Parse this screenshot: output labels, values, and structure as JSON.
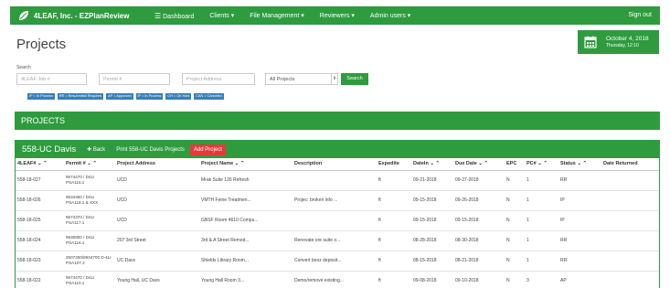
{
  "nav": {
    "brand": "4LEAF, Inc. - EZPlanReview",
    "menu": [
      {
        "label": "Dashboard",
        "icon": "menu-icon"
      },
      {
        "label": "Clients ▾"
      },
      {
        "label": "File Management ▾"
      },
      {
        "label": "Reviewers ▾"
      },
      {
        "label": "Admin users ▾"
      }
    ],
    "signout": "Sign out"
  },
  "page_title": "Projects",
  "date": {
    "line1": "October 4, 2018",
    "line2": "Thursday, 12:10"
  },
  "search": {
    "label": "Search",
    "job_placeholder": "4LEAF Job #",
    "permit_placeholder": "Permit #",
    "address_placeholder": "Project Address",
    "filter_value": "All Projects",
    "button": "Search"
  },
  "legend": [
    "IP = In Process",
    "RR = Resubmittal Required",
    "AP = Approved",
    "IP = In Process",
    "OH = On Hold",
    "CAN = Canceled"
  ],
  "projects_header": "PROJECTS",
  "panel": {
    "title": "558-UC Davis",
    "back": "Back",
    "print": "Print 558-UC Davis Projects",
    "add": "Add Project"
  },
  "table": {
    "headers": [
      "4LEAF# ⌄ ⌃",
      "Permit # ⌄ ⌃",
      "Project Address",
      "Project Name ⌄ ⌃",
      "Description",
      "Expedite",
      "DateIn ⌄ ⌃",
      "Due Date ⌄ ⌃",
      "EPC",
      "PC# ⌄ ⌃",
      "Status ⌄ ⌃",
      "Date Returned"
    ],
    "rows": [
      [
        "558-18-027",
        "9574470 / D4LI PSA116.1",
        "UCD",
        "Mrak Suite 126 Refresh",
        "",
        "ft",
        "09-21-2018",
        "09-27-2018",
        "N",
        "1",
        "RR",
        ""
      ],
      [
        "558-18-026",
        "9534360 / D4LI PSA118.1 & XXX",
        "UCD",
        "VMTH Feine Treatmen...",
        "Projec: broken info ...",
        "ft",
        "09-15-2018",
        "09-26-2018",
        "N",
        "1",
        "IP",
        ""
      ],
      [
        "558-18-025",
        "9574370 / D4LI PSA117.1",
        "UCD",
        "GBSF Room 4610 Compu...",
        "",
        "ft",
        "09-15-2018",
        "09-15-2018",
        "N",
        "1",
        "IP",
        ""
      ],
      [
        "558-18-024",
        "9630800 / D4LI PSA116.1",
        "207 3rd Street",
        "3rd & A Street Remod...",
        "Renovate ore suite o...",
        "ft",
        "08-28-2018",
        "08-30-2018",
        "N",
        "1",
        "RR",
        ""
      ],
      [
        "558-18-023",
        "2507250/9534700 D-4LI PSA107.2",
        "UC Davs",
        "Shields Library Room...",
        "Convert booz deposit...",
        "ft",
        "08-15-2018",
        "08-21-2018",
        "N",
        "1",
        "RR",
        ""
      ],
      [
        "558-18-022",
        "9574470 / D4LI PSA110.1",
        "Young Hall, UC Davs",
        "Young Hall Room 3...",
        "Demo/remove existing...",
        "ft",
        "09-08-2018",
        "09-10-2018",
        "N",
        "3",
        "AP",
        ""
      ]
    ]
  }
}
